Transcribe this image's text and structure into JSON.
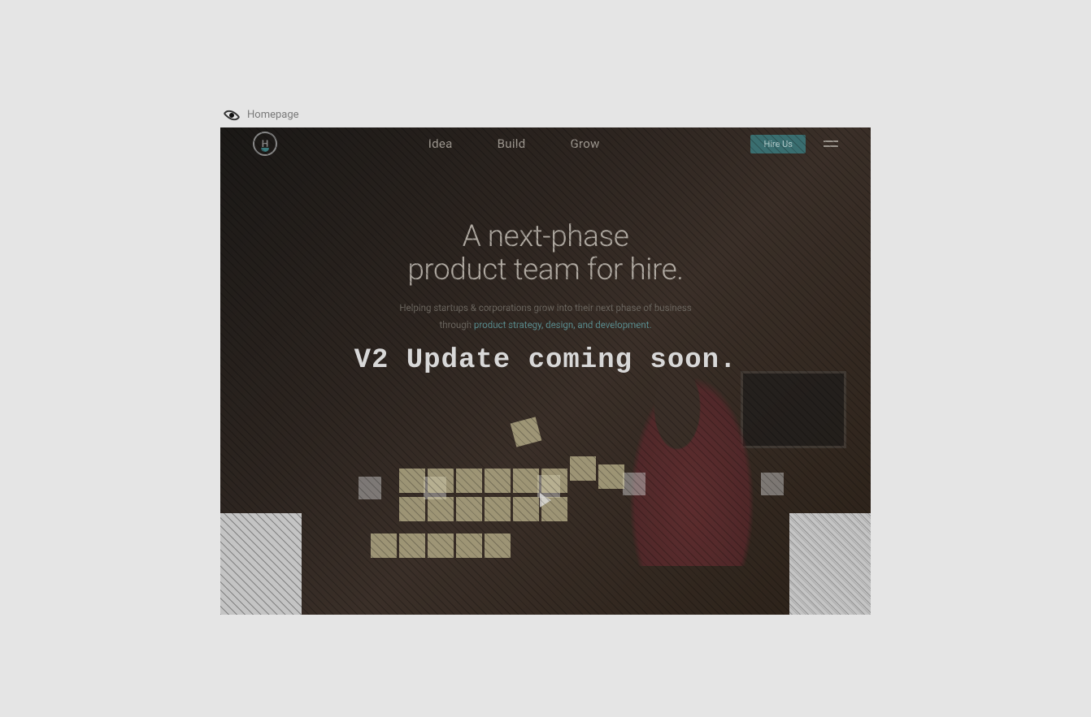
{
  "preview": {
    "label": "Homepage"
  },
  "nav": {
    "logo_letter": "H",
    "links": [
      "Idea",
      "Build",
      "Grow"
    ],
    "cta_label": "Hire Us"
  },
  "hero": {
    "title_line1": "A next-phase",
    "title_line2": "product team for hire.",
    "sub_line1": "Helping startups & corporations grow into their next phase of business",
    "sub_line2_prefix": "through ",
    "sub_line2_accent": "product strategy, design, and development."
  },
  "overlay": {
    "message": "V2 Update coming soon."
  },
  "colors": {
    "page_bg": "#e5e5e5",
    "accent": "#3b7a7d",
    "nav_text": "#a09a92",
    "hero_text": "#b0aaa2",
    "overlay_text": "#d8d8d8"
  }
}
